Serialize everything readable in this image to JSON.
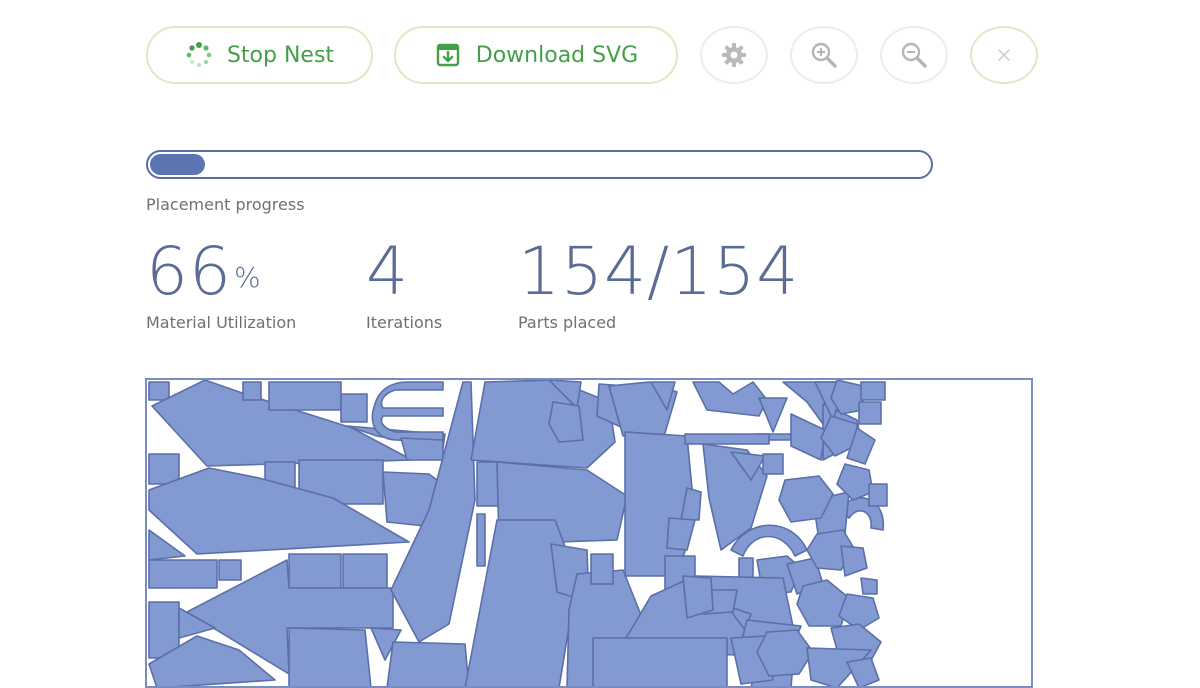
{
  "toolbar": {
    "stop_label": "Stop Nest",
    "download_label": "Download SVG",
    "settings_icon": "gear-icon",
    "zoom_in_icon": "zoom-in-icon",
    "zoom_out_icon": "zoom-out-icon",
    "close_icon": "close-icon"
  },
  "progress": {
    "label": "Placement progress",
    "value": 0.07
  },
  "stats": {
    "utilization_value": "66",
    "utilization_unit": "%",
    "utilization_label": "Material Utilization",
    "iterations_value": "4",
    "iterations_label": "Iterations",
    "parts_value": "154/154",
    "parts_label": "Parts placed"
  },
  "colors": {
    "accent_green": "#43a047",
    "part_fill": "#8399d1",
    "part_stroke": "#5b6fa8",
    "progress_fill": "#5b75b3",
    "stat_text": "#5b6c94"
  }
}
